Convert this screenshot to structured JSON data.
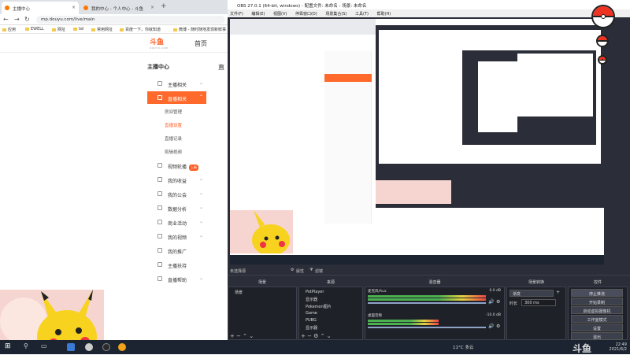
{
  "browser": {
    "tabs": [
      {
        "label": "主播中心"
      },
      {
        "label": "我的中心 - 个人中心 - 斗鱼"
      }
    ],
    "url": "mp.douyu.com/live/main",
    "bookmarks": [
      "应用",
      "EWELL",
      "网址",
      "tel",
      "常用网址",
      "百度一下，你就知道",
      "微博 - 随时随地发现新鲜事"
    ]
  },
  "site": {
    "logo_text": "斗鱼",
    "logo_sub": "DOUYU.COM",
    "nav_home": "首页",
    "content_stub": "直"
  },
  "sidebar": {
    "title": "主播中心",
    "items": [
      {
        "label": "主播相关",
        "expanded": true
      },
      {
        "label": "直播相关",
        "active": true
      },
      {
        "label": "房间管理",
        "sub": true
      },
      {
        "label": "直播设置",
        "sub": true,
        "highlight": true
      },
      {
        "label": "直播记录",
        "sub": true
      },
      {
        "label": "剪辑视频",
        "sub": true
      },
      {
        "label": "视频轮播",
        "badge": "上新"
      },
      {
        "label": "我的收益"
      },
      {
        "label": "我的公会"
      },
      {
        "label": "数据分析"
      },
      {
        "label": "商业活动"
      },
      {
        "label": "我的视频"
      },
      {
        "label": "我的推广"
      },
      {
        "label": "主播扶持"
      },
      {
        "label": "直播帮助"
      }
    ]
  },
  "obs": {
    "title": "OBS 27.0.1 (64-bit, windows) - 配置文件: 未命名 - 场景: 未命名",
    "menu": [
      "文件(F)",
      "编辑(E)",
      "视图(V)",
      "停靠窗口(D)",
      "场景集合(S)",
      "工具(T)",
      "帮助(H)"
    ],
    "status_text": "未选择源",
    "prop_btn": "属性",
    "filter_btn": "滤镜",
    "docks": {
      "scenes": {
        "title": "场景",
        "items": [
          "场景"
        ]
      },
      "sources": {
        "title": "来源",
        "items": [
          "PotPlayer",
          "显示器",
          "Pokemon图片",
          "Game",
          "PUBG",
          "显示器"
        ]
      },
      "mixer": {
        "title": "混音器",
        "channels": [
          {
            "name": "麦克风/Aux",
            "db": "0.0 dB"
          },
          {
            "name": "桌面音频",
            "db": "-10.0 dB"
          }
        ]
      },
      "transitions": {
        "title": "场景转换",
        "type": "渐变",
        "duration_label": "时长",
        "duration": "300 ms"
      },
      "controls": {
        "title": "控件",
        "buttons": [
          "停止推流",
          "开始录制",
          "启动虚拟摄像机",
          "工作室模式",
          "设置",
          "退出"
        ]
      }
    }
  },
  "taskbar": {
    "weather": "11°C 多云",
    "time": "22:49",
    "date": "2021/6/2"
  },
  "colors": {
    "brand": "#ff5d23",
    "obs_bg": "#2b2e38",
    "taskbar": "#1b2430"
  },
  "watermark": "斗鱼"
}
